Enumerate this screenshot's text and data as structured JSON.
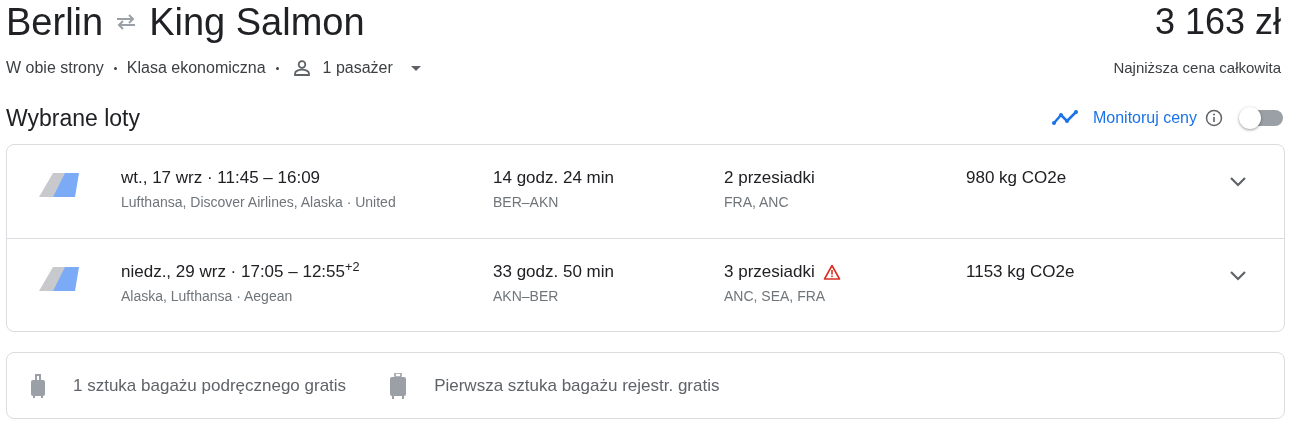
{
  "route": {
    "origin": "Berlin",
    "destination": "King Salmon"
  },
  "price": {
    "amount": "3 163 zł",
    "caption": "Najniższa cena całkowita"
  },
  "options": {
    "trip_type": "W obie strony",
    "cabin": "Klasa ekonomiczna",
    "passengers": "1 pasażer"
  },
  "section_title": "Wybrane loty",
  "price_tracking": {
    "label": "Monitoruj ceny",
    "on": false
  },
  "flights": [
    {
      "schedule": "wt., 17 wrz · 11:45 – 16:09",
      "airlines": "Lufthansa, Discover Airlines, Alaska · United",
      "duration": "14 godz. 24 min",
      "route": "BER–AKN",
      "stops": "2 przesiadki",
      "warning": false,
      "stop_airports": "FRA, ANC",
      "emissions": "980 kg CO2e"
    },
    {
      "schedule": "niedz., 29 wrz · 17:05 – 12:55$^{+2}$",
      "airlines": "Alaska, Lufthansa · Aegean",
      "duration": "33 godz. 50 min",
      "route": "AKN–BER",
      "stops": "3 przesiadki",
      "warning": true,
      "stop_airports": "ANC, SEA, FRA",
      "emissions": "1153 kg CO2e"
    }
  ],
  "baggage": [
    {
      "kind": "carry_on",
      "text": "1 sztuka bagażu podręcznego gratis"
    },
    {
      "kind": "checked",
      "text": "Pierwsza sztuka bagażu rejestr. gratis"
    }
  ]
}
